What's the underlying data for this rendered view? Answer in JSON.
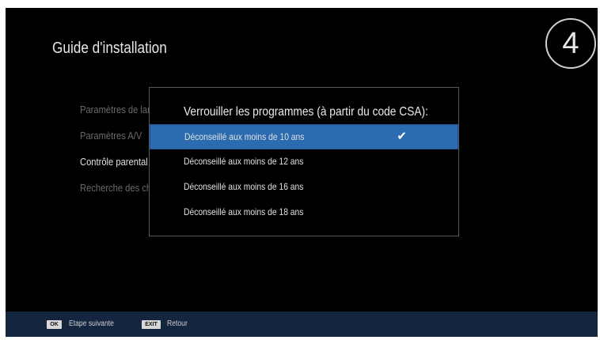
{
  "header": {
    "title": "Guide d'installation",
    "step_number": "4"
  },
  "menu": {
    "items": [
      {
        "label": "Paramètres de langue",
        "active": false
      },
      {
        "label": "Paramètres A/V",
        "active": false
      },
      {
        "label": "Contrôle parental",
        "active": true
      },
      {
        "label": "Recherche des chaînes",
        "active": false
      }
    ]
  },
  "dialog": {
    "title": "Verrouiller les programmes (à partir du code CSA):",
    "options": [
      {
        "label": "Déconseillé aux moins de 10 ans",
        "selected": true
      },
      {
        "label": "Déconseillé aux moins de 12 ans",
        "selected": false
      },
      {
        "label": "Déconseillé aux moins de 16 ans",
        "selected": false
      },
      {
        "label": "Déconseillé aux moins de 18 ans",
        "selected": false
      }
    ],
    "selected_icon": "checkmark-icon"
  },
  "footer": {
    "ok_key": "OK",
    "ok_label": "Etape suivante",
    "exit_key": "EXIT",
    "exit_label": "Retour"
  },
  "colors": {
    "background": "#000000",
    "selection": "#2b6cb0",
    "footer": "#142540"
  }
}
